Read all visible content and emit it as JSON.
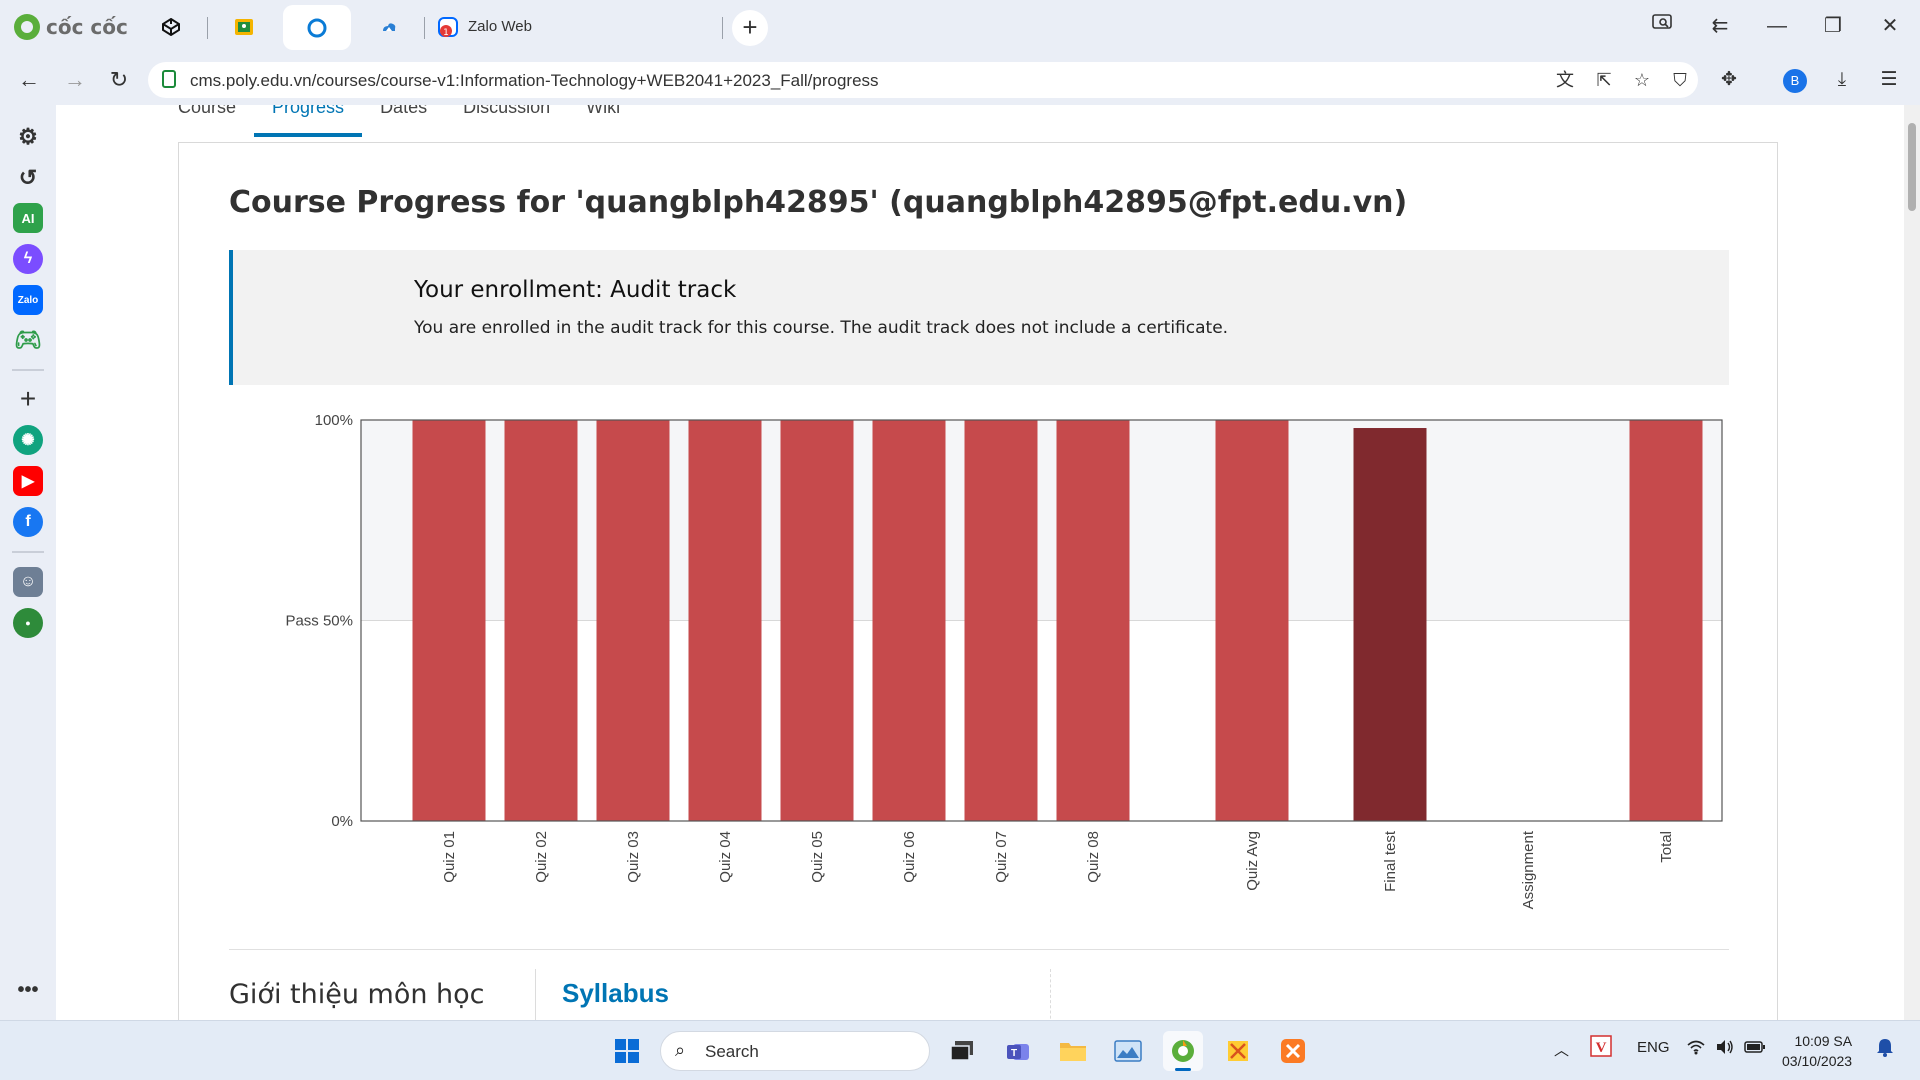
{
  "browser": {
    "brand": "cốc cốc",
    "tabs": [
      {
        "icon": "codepen-icon"
      },
      {
        "icon": "google-classroom-icon"
      },
      {
        "icon": "circle-tab-icon",
        "active": true
      },
      {
        "icon": "cloud-tab-icon"
      },
      {
        "icon": "zalo-icon",
        "title": "Zalo Web"
      }
    ],
    "url": "cms.poly.edu.vn/courses/course-v1:Information-Technology+WEB2041+2023_Fall/progress",
    "profile_initial": "B"
  },
  "course_tabs": [
    {
      "label": "Course",
      "active": false
    },
    {
      "label": "Progress",
      "active": true
    },
    {
      "label": "Dates",
      "active": false
    },
    {
      "label": "Discussion",
      "active": false
    },
    {
      "label": "Wiki",
      "active": false
    }
  ],
  "page": {
    "title": "Course Progress for 'quangblph42895' (quangblph42895@fpt.edu.vn)",
    "enrollment": {
      "title": "Your enrollment: Audit track",
      "description": "You are enrolled in the audit track for this course. The audit track does not include a certificate."
    },
    "intro_label": "Giới thiệu môn học",
    "syllabus_label": "Syllabus"
  },
  "chart_data": {
    "type": "bar",
    "categories": [
      "Quiz 01",
      "Quiz 02",
      "Quiz 03",
      "Quiz 04",
      "Quiz 05",
      "Quiz 06",
      "Quiz 07",
      "Quiz 08",
      "Quiz Avg",
      "Final test",
      "Assignment",
      "Total"
    ],
    "values": [
      100,
      100,
      100,
      100,
      100,
      100,
      100,
      100,
      100,
      98,
      0,
      100
    ],
    "yticks": [
      {
        "value": 0,
        "label": "0%"
      },
      {
        "value": 50,
        "label": "Pass 50%"
      },
      {
        "value": 100,
        "label": "100%"
      }
    ],
    "ylim": [
      0,
      100
    ],
    "colors": {
      "quiz": "#c64a4c",
      "final": "#80292e",
      "pass_band": "#f5f6f8"
    }
  },
  "taskbar": {
    "search_placeholder": "Search",
    "language": "ENG",
    "time": "10:09 SA",
    "date": "03/10/2023"
  }
}
